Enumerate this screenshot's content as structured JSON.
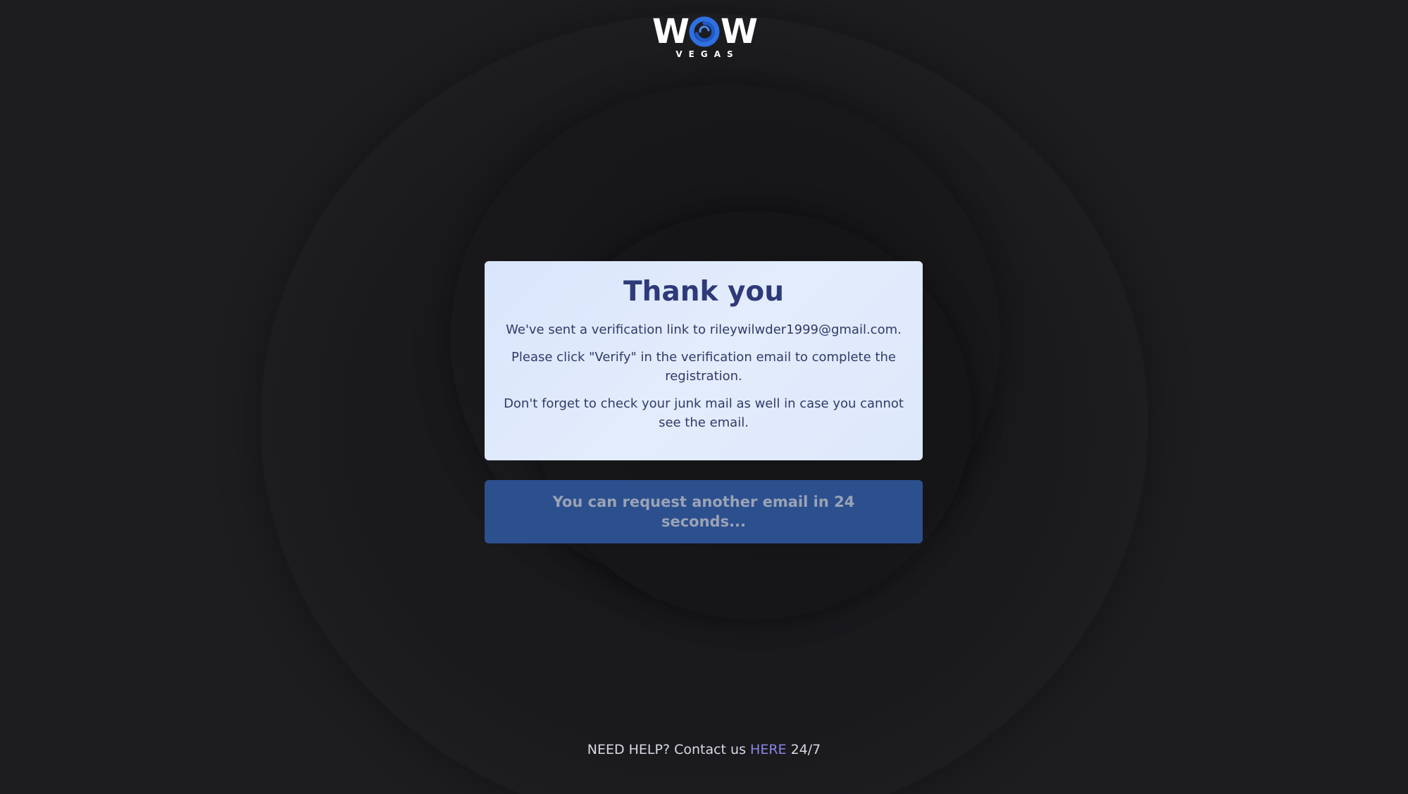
{
  "logo": {
    "letters_left": "W",
    "letters_right": "W",
    "subtitle": "VEGAS",
    "icon": "swirl-o-icon",
    "colors": {
      "text": "#ffffff",
      "accent": "#2f6fe0"
    }
  },
  "card": {
    "title": "Thank you",
    "line1": "We've sent a verification link to rileywilwder1999@gmail.com.",
    "line2": "Please click \"Verify\" in the verification email to complete the registration.",
    "line3": "Don't forget to check your junk mail as well in case you cannot see the email."
  },
  "resend": {
    "label": "You can request another email in 24 seconds...",
    "countdown_seconds": 24
  },
  "footer": {
    "prefix": "NEED HELP? Contact us ",
    "link": "HERE",
    "suffix": " 24/7"
  },
  "colors": {
    "background": "#1d1d20",
    "card": "#dfe9fb",
    "card_title": "#2e3a78",
    "button": "#2c4f8e",
    "link": "#8b86e8"
  }
}
